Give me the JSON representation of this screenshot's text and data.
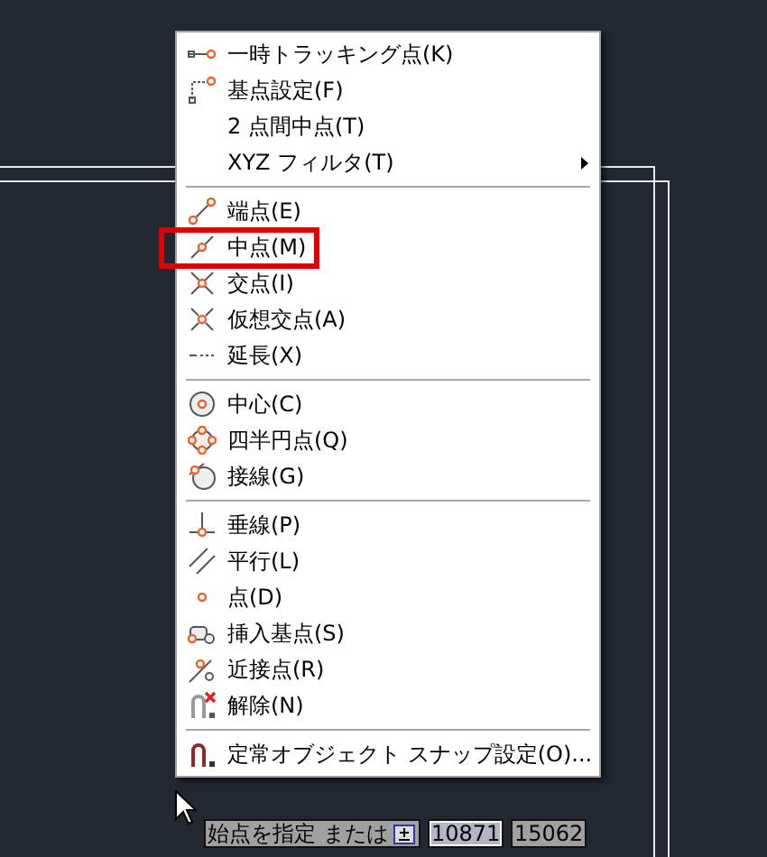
{
  "menu": {
    "items": [
      {
        "kind": "item",
        "label": "一時トラッキング点(K)",
        "highlighted": false
      },
      {
        "kind": "item",
        "label": "基点設定(F)",
        "highlighted": false
      },
      {
        "kind": "item",
        "label": "2 点間中点(T)",
        "highlighted": false
      },
      {
        "kind": "submenu",
        "label": "XYZ フィルタ(T)",
        "highlighted": false
      },
      {
        "kind": "separator"
      },
      {
        "kind": "item",
        "label": "端点(E)",
        "highlighted": false
      },
      {
        "kind": "item",
        "label": "中点(M)",
        "highlighted": true
      },
      {
        "kind": "item",
        "label": "交点(I)",
        "highlighted": false
      },
      {
        "kind": "item",
        "label": "仮想交点(A)",
        "highlighted": false
      },
      {
        "kind": "item",
        "label": "延長(X)",
        "highlighted": false
      },
      {
        "kind": "separator"
      },
      {
        "kind": "item",
        "label": "中心(C)",
        "highlighted": false
      },
      {
        "kind": "item",
        "label": "四半円点(Q)",
        "highlighted": false
      },
      {
        "kind": "item",
        "label": "接線(G)",
        "highlighted": false
      },
      {
        "kind": "separator"
      },
      {
        "kind": "item",
        "label": "垂線(P)",
        "highlighted": false
      },
      {
        "kind": "item",
        "label": "平行(L)",
        "highlighted": false
      },
      {
        "kind": "item",
        "label": "点(D)",
        "highlighted": false
      },
      {
        "kind": "item",
        "label": "挿入基点(S)",
        "highlighted": false
      },
      {
        "kind": "item",
        "label": "近接点(R)",
        "highlighted": false
      },
      {
        "kind": "item",
        "label": "解除(N)",
        "highlighted": false
      },
      {
        "kind": "separator"
      },
      {
        "kind": "item",
        "label": "定常オブジェクト スナップ設定(O)...",
        "highlighted": false
      }
    ]
  },
  "command_line": {
    "prompt": "始点を指定 または",
    "x_value": "10871",
    "y_value": "15062"
  }
}
